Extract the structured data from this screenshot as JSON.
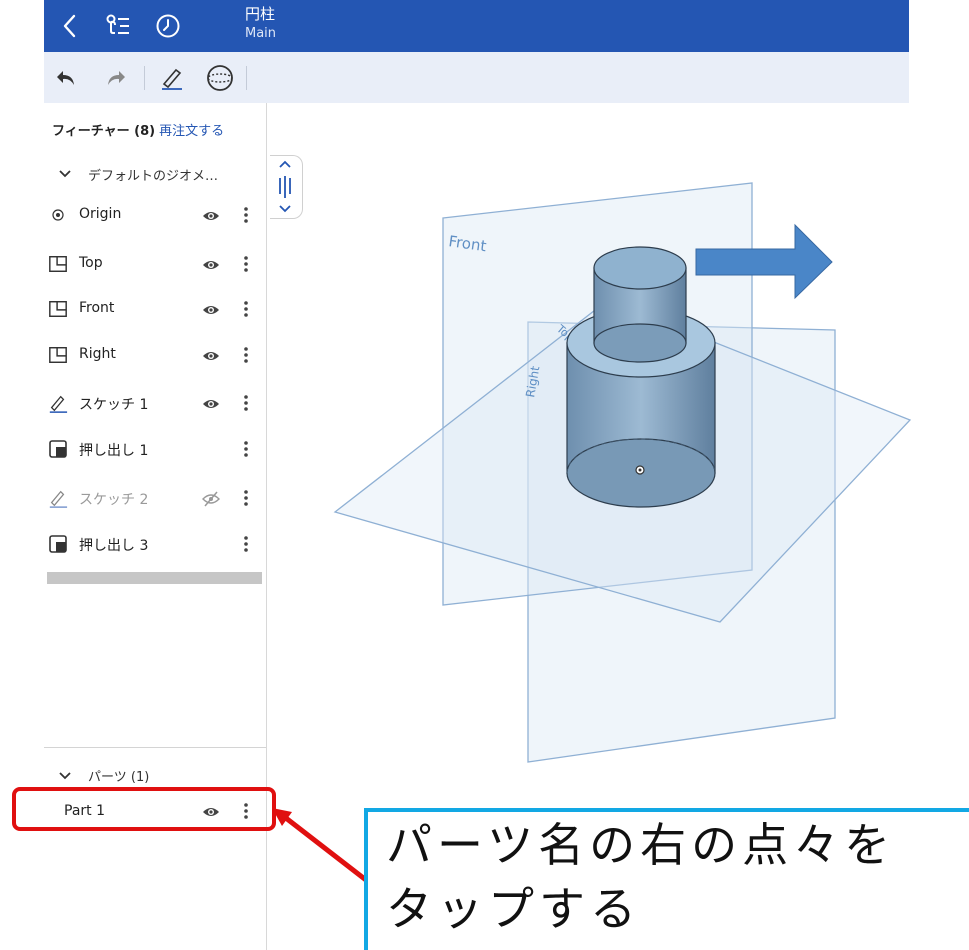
{
  "topbar": {
    "document_title": "円柱",
    "workspace": "Main",
    "icons": [
      "back-chevron-icon",
      "feature-tree-icon",
      "history-clock-icon"
    ]
  },
  "toolbar": {
    "icons": [
      "undo-icon",
      "redo-icon",
      "sketch-pencil-icon",
      "view-cube-icon"
    ]
  },
  "feature_panel": {
    "header": "フィーチャー (8)",
    "reorder_link": "再注文する",
    "group_label": "デフォルトのジオメ…",
    "features": [
      {
        "name": "Origin",
        "icon": "origin-icon",
        "visible": true,
        "dim": false
      },
      {
        "name": "Top",
        "icon": "plane-icon",
        "visible": true,
        "dim": false
      },
      {
        "name": "Front",
        "icon": "plane-icon",
        "visible": true,
        "dim": false
      },
      {
        "name": "Right",
        "icon": "plane-icon",
        "visible": true,
        "dim": false
      },
      {
        "name": "スケッチ 1",
        "icon": "sketch-icon",
        "visible": true,
        "dim": false
      },
      {
        "name": "押し出し 1",
        "icon": "extrude-icon",
        "visible": null,
        "dim": false
      },
      {
        "name": "スケッチ 2",
        "icon": "sketch-icon",
        "visible": false,
        "dim": true
      },
      {
        "name": "押し出し 3",
        "icon": "extrude-icon",
        "visible": null,
        "dim": false
      }
    ],
    "parts_label": "パーツ (1)",
    "parts": [
      {
        "name": "Part 1",
        "visible": true
      }
    ]
  },
  "viewport": {
    "plane_labels": {
      "front": "Front",
      "top": "Top",
      "right": "Right"
    }
  },
  "callout": {
    "line1": "パーツ名の右の点々を",
    "line2": "タップする"
  },
  "colors": {
    "brand": "#2456b3",
    "highlight_border": "#e01010",
    "callout_border": "#12a8e4",
    "arrow_fill": "#4a86c8"
  }
}
